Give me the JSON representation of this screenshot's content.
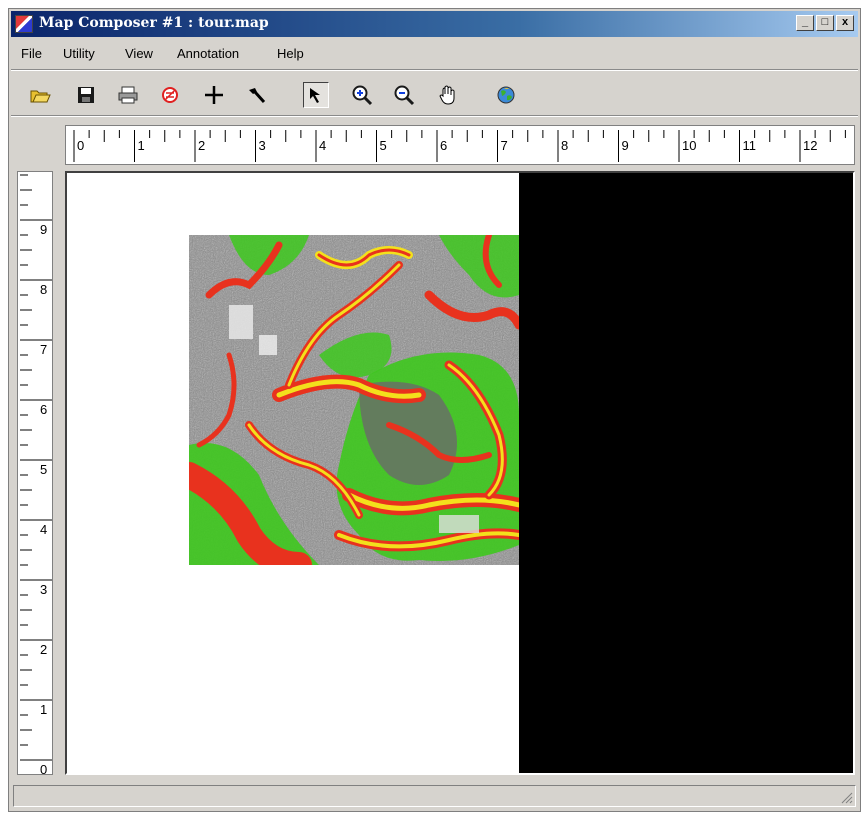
{
  "window": {
    "title": "Map Composer #1 : tour.map",
    "controls": {
      "minimize": "_",
      "maximize": "□",
      "close": "x"
    }
  },
  "menu": [
    "File",
    "Utility",
    "View",
    "Annotation",
    "Help"
  ],
  "toolbar": {
    "tools": [
      {
        "name": "open-icon"
      },
      {
        "name": "save-icon"
      },
      {
        "name": "print-icon"
      },
      {
        "name": "clear-icon"
      },
      {
        "name": "crosshair-icon"
      },
      {
        "name": "hammer-icon"
      },
      {
        "name": "select-arrow-icon",
        "active": true
      },
      {
        "name": "zoom-in-icon"
      },
      {
        "name": "zoom-out-icon"
      },
      {
        "name": "pan-hand-icon"
      },
      {
        "name": "globe-icon"
      }
    ]
  },
  "rulers": {
    "horizontal_labels": [
      "0",
      "1",
      "2",
      "3",
      "4",
      "5",
      "6",
      "7",
      "8",
      "9",
      "10",
      "11",
      "12"
    ],
    "vertical_labels": [
      "9",
      "8",
      "7",
      "6",
      "5",
      "4",
      "3",
      "2",
      "1",
      "0"
    ]
  },
  "colors": {
    "title_start": "#0a246a",
    "chrome": "#d6d3ce",
    "map_green": "#3ec81e",
    "map_red": "#e8321e",
    "map_yellow": "#f3e01c",
    "map_gray": "#8a8a8a"
  },
  "status": {
    "text": ""
  }
}
